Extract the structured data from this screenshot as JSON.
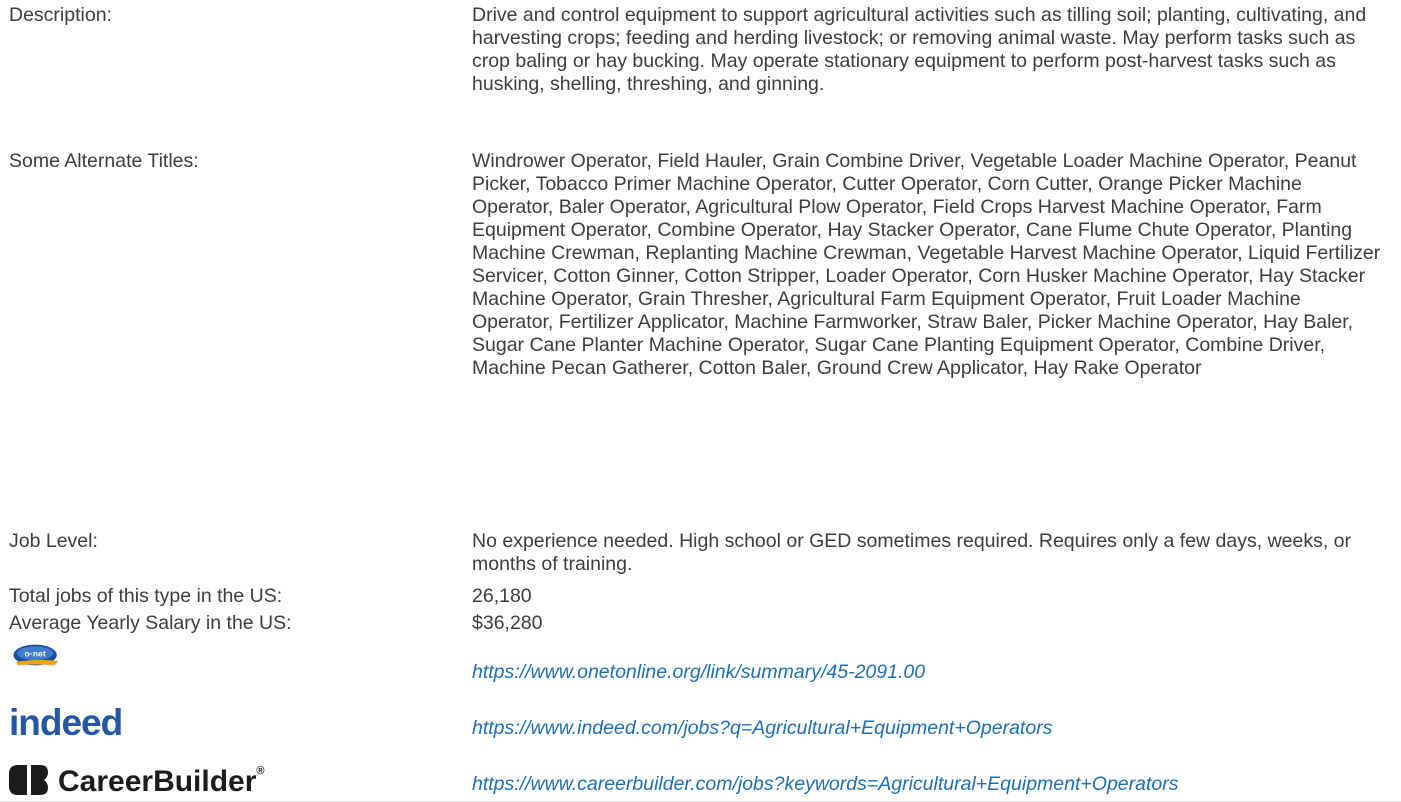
{
  "rows": {
    "description": {
      "label": "Description:",
      "value": "Drive and control equipment to support agricultural activities such as tilling soil; planting, cultivating, and harvesting crops; feeding and herding livestock; or removing animal waste. May perform tasks such as crop baling or hay bucking. May operate stationary equipment to perform post-harvest tasks such as husking, shelling, threshing, and ginning."
    },
    "alternate_titles": {
      "label": "Some Alternate Titles:",
      "value": "Windrower Operator, Field Hauler, Grain Combine Driver, Vegetable Loader Machine Operator, Peanut Picker, Tobacco Primer Machine Operator, Cutter Operator, Corn Cutter, Orange Picker Machine Operator, Baler Operator, Agricultural Plow Operator, Field Crops Harvest Machine Operator, Farm Equipment Operator, Combine Operator, Hay Stacker Operator, Cane Flume Chute Operator, Planting Machine Crewman, Replanting Machine Crewman, Vegetable Harvest Machine Operator, Liquid Fertilizer Servicer, Cotton Ginner, Cotton Stripper, Loader Operator, Corn Husker Machine Operator, Hay Stacker Machine Operator, Grain Thresher, Agricultural Farm Equipment Operator, Fruit Loader Machine Operator, Fertilizer Applicator, Machine Farmworker, Straw Baler, Picker Machine Operator, Hay Baler, Sugar Cane Planter Machine Operator, Sugar Cane Planting Equipment Operator, Combine Driver, Machine Pecan Gatherer, Cotton Baler, Ground Crew Applicator, Hay Rake Operator"
    },
    "job_level": {
      "label": "Job Level:",
      "value": "No experience needed. High school or GED sometimes required. Requires only a few days, weeks, or months of training."
    },
    "total_jobs": {
      "label": "Total jobs of this type in the US:",
      "value": "26,180"
    },
    "salary": {
      "label": "Average Yearly Salary in the US:",
      "value": "$36,280"
    }
  },
  "links": {
    "onet": {
      "logo_text": "o·net",
      "url": "https://www.onetonline.org/link/summary/45-2091.00",
      "icon": "onet-logo"
    },
    "indeed": {
      "logo_text": "indeed",
      "url": "https://www.indeed.com/jobs?q=Agricultural+Equipment+Operators",
      "icon": "indeed-logo",
      "color": "#2557a7"
    },
    "careerbuilder": {
      "logo_text": "CareerBuilder",
      "logo_mark": "®",
      "url": "https://www.careerbuilder.com/jobs?keywords=Agricultural+Equipment+Operators",
      "icon": "careerbuilder-logo"
    }
  },
  "colors": {
    "text": "#3d3d3d",
    "link": "#1f6fb2",
    "indeed_blue": "#2557a7",
    "onet_blue": "#1a4e9a",
    "onet_orange": "#f4a21b"
  }
}
